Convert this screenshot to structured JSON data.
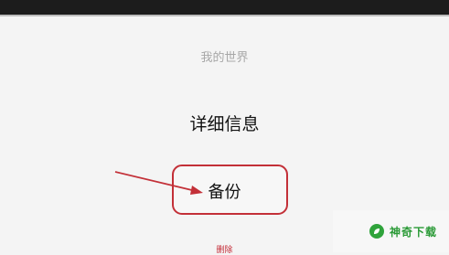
{
  "menu": {
    "title": "我的世界",
    "items": [
      {
        "label": "详细信息"
      },
      {
        "label": "备份"
      },
      {
        "label": "删除"
      }
    ]
  },
  "annotation": {
    "color": "#c33038"
  },
  "watermark": {
    "text": "神奇下载",
    "icon": "leaf-icon",
    "color": "#2a9a36"
  }
}
